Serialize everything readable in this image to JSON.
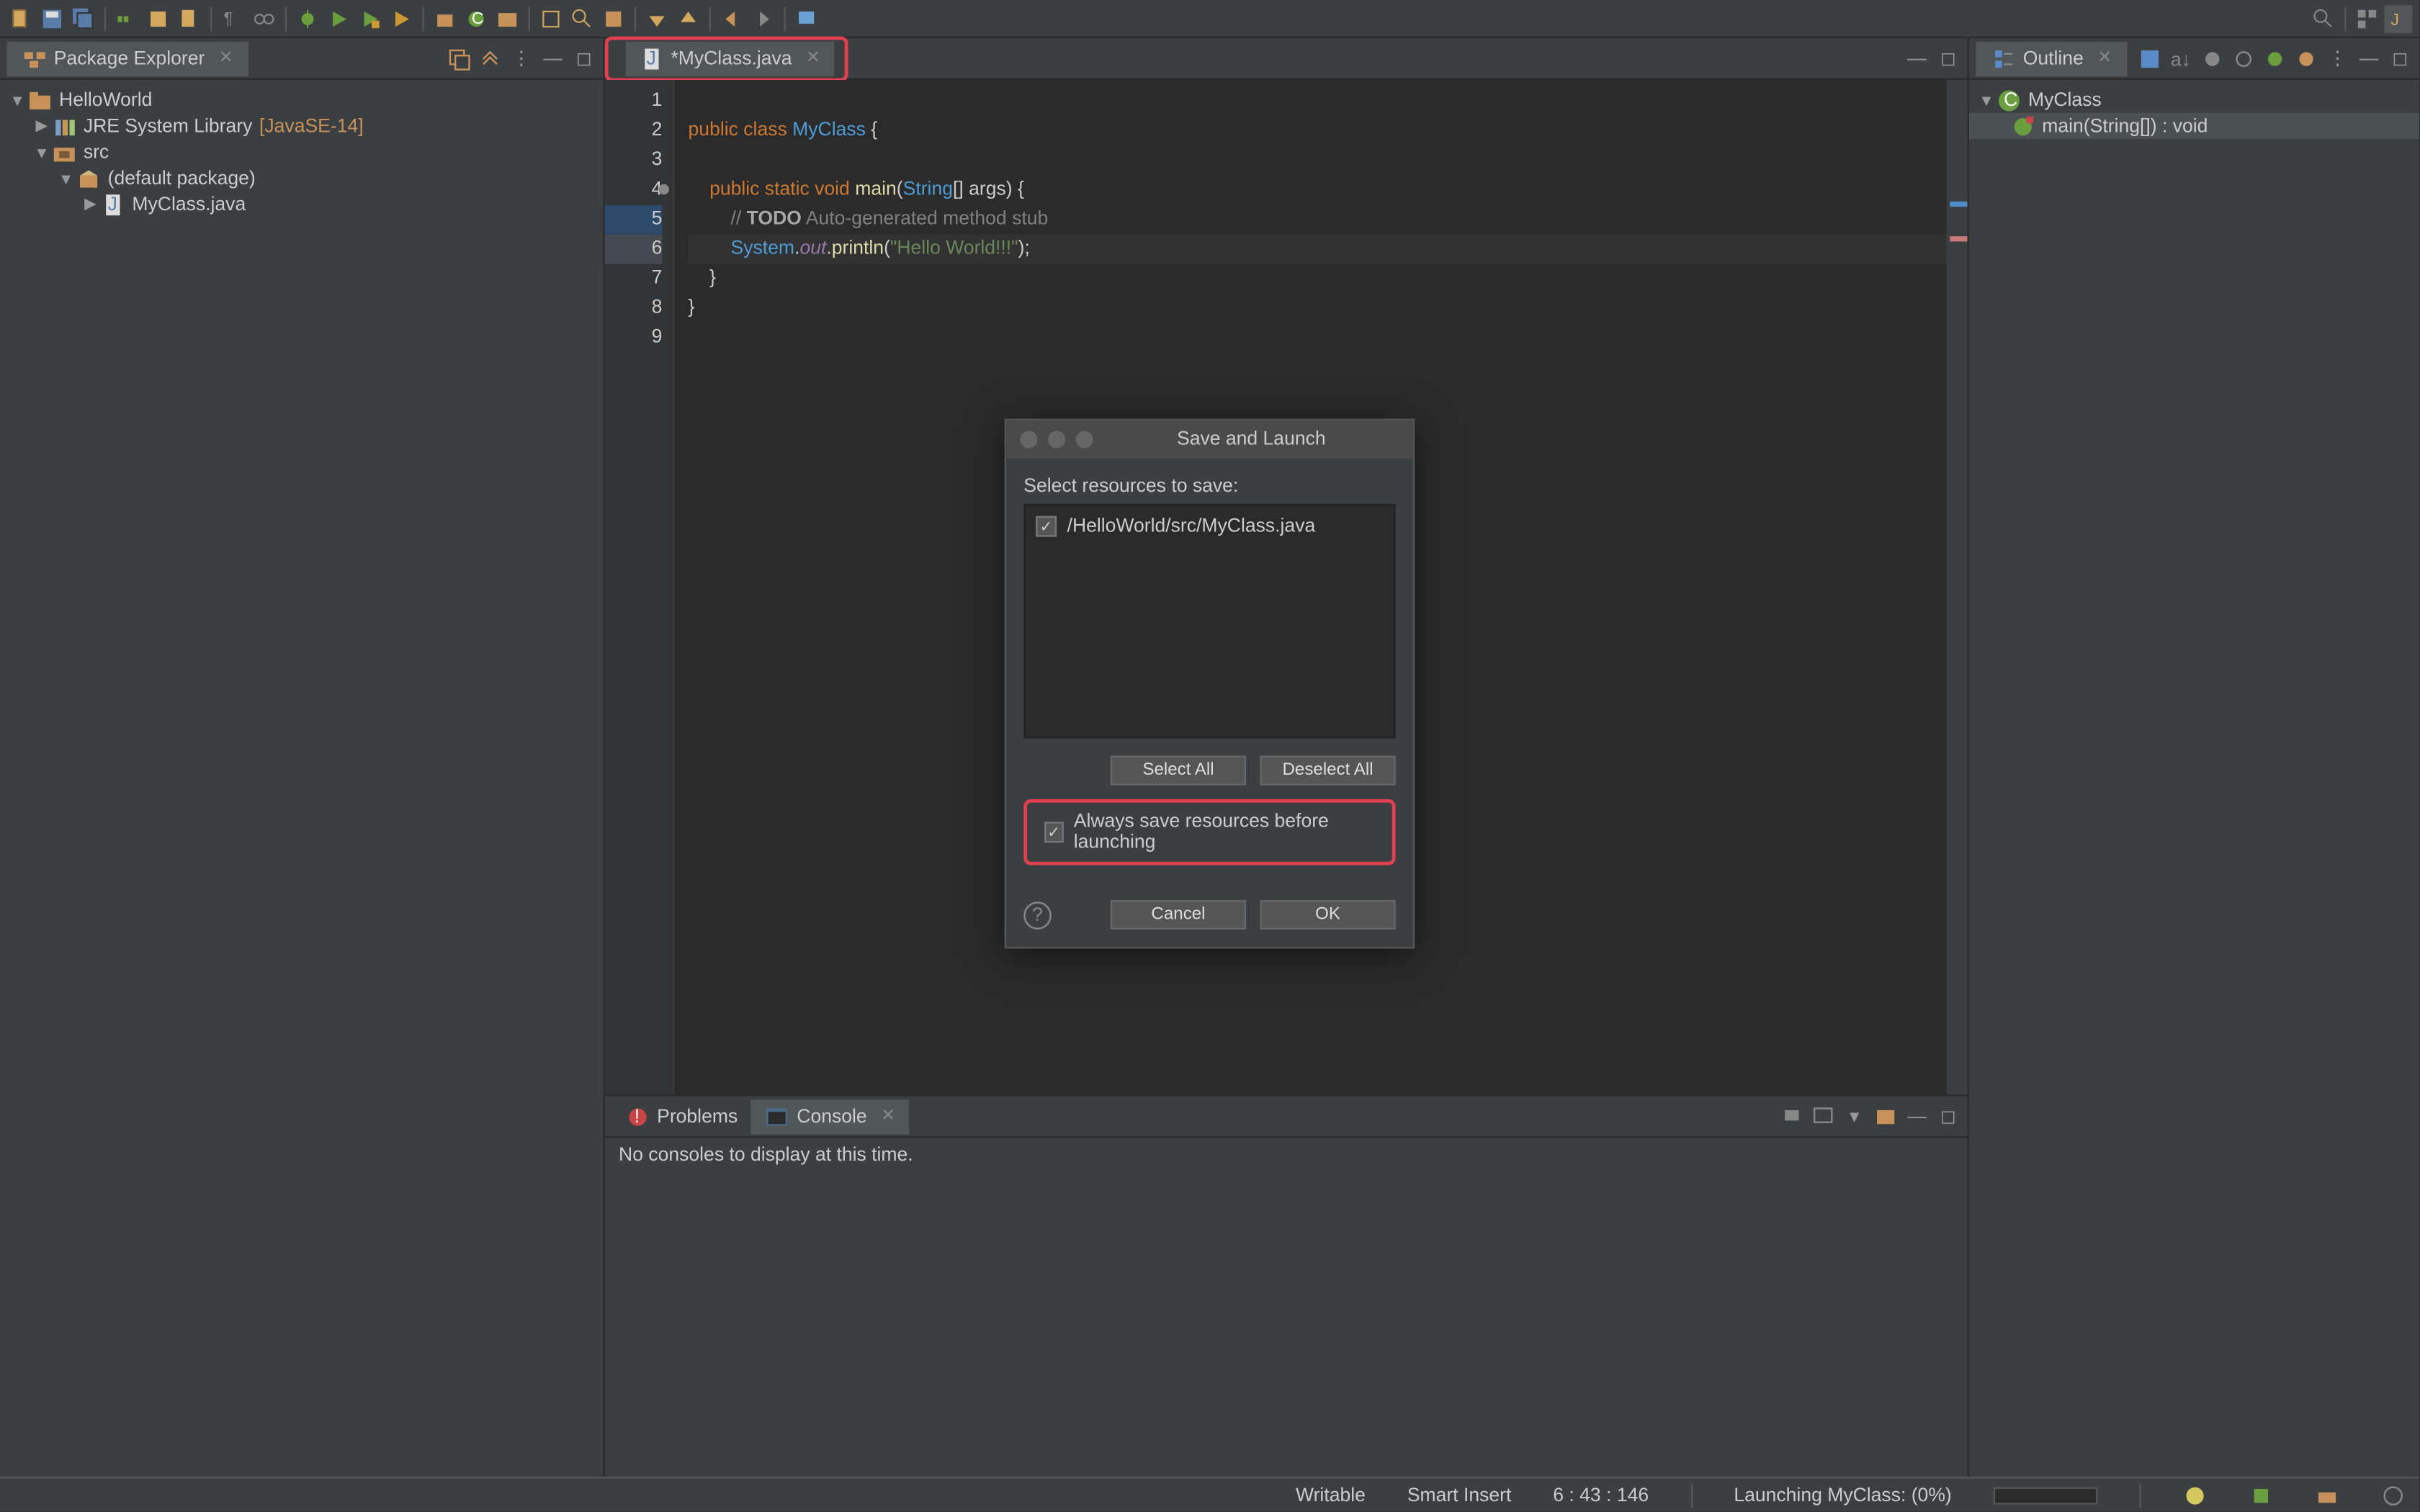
{
  "package_explorer": {
    "title": "Package Explorer",
    "tree": {
      "project": "HelloWorld",
      "jre": "JRE System Library",
      "jre_version": "[JavaSE-14]",
      "src": "src",
      "pkg": "(default package)",
      "file": "MyClass.java"
    }
  },
  "editor": {
    "tab": "*MyClass.java",
    "lines": [
      "1",
      "2",
      "3",
      "4",
      "5",
      "6",
      "7",
      "8",
      "9"
    ],
    "code": {
      "l2_public": "public ",
      "l2_class": "class ",
      "l2_name": "MyClass",
      "l2_brace": " {",
      "l4_indent": "    ",
      "l4_public": "public ",
      "l4_static": "static ",
      "l4_void": "void ",
      "l4_main": "main",
      "l4_args1": "(",
      "l4_string": "String",
      "l4_args2": "[] ",
      "l4_args": "args",
      "l4_args3": ") {",
      "l5_indent": "        ",
      "l5_comment": "// ",
      "l5_todo": "TODO",
      "l5_rest": " Auto-generated method stub",
      "l6_indent": "        ",
      "l6_system": "System",
      "l6_dot1": ".",
      "l6_out": "out",
      "l6_dot2": ".",
      "l6_println": "println",
      "l6_p1": "(",
      "l6_str": "\"Hello World!!!\"",
      "l6_p2": ");",
      "l7": "    }",
      "l8": "}"
    }
  },
  "outline": {
    "title": "Outline",
    "class": "MyClass",
    "method": "main(String[]) : void"
  },
  "bottom": {
    "problems": "Problems",
    "console": "Console",
    "empty": "No consoles to display at this time."
  },
  "status": {
    "writable": "Writable",
    "insert": "Smart Insert",
    "pos": "6 : 43 : 146",
    "launch": "Launching MyClass: (0%)"
  },
  "dialog": {
    "title": "Save and Launch",
    "prompt": "Select resources to save:",
    "resource": "/HelloWorld/src/MyClass.java",
    "select_all": "Select All",
    "deselect_all": "Deselect All",
    "always": "Always save resources before launching",
    "cancel": "Cancel",
    "ok": "OK"
  }
}
